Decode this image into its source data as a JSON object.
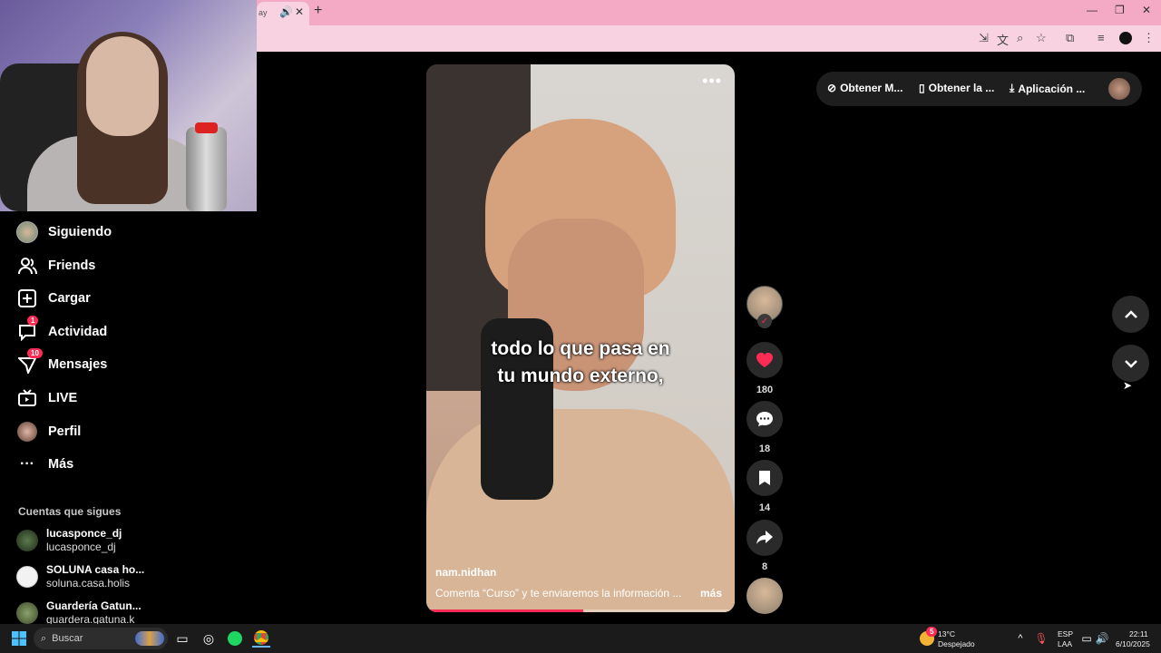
{
  "browser": {
    "tab_title": "ay",
    "icons": [
      "speaker-icon",
      "close-icon",
      "new-tab-icon"
    ],
    "address_icons": [
      "install-app-icon",
      "translate-icon",
      "zoom-icon",
      "bookmark-star-icon",
      "extensions-icon",
      "media-control-icon",
      "profile-icon",
      "kebab-menu-icon"
    ]
  },
  "sidebar": {
    "items": [
      {
        "label": "Siguiendo",
        "icon": "following-avatar-icon"
      },
      {
        "label": "Friends",
        "icon": "friends-icon"
      },
      {
        "label": "Cargar",
        "icon": "upload-icon"
      },
      {
        "label": "Actividad",
        "icon": "activity-icon",
        "badge": "1"
      },
      {
        "label": "Mensajes",
        "icon": "messages-icon",
        "badge": "10"
      },
      {
        "label": "LIVE",
        "icon": "live-icon"
      },
      {
        "label": "Perfil",
        "icon": "profile-avatar-icon"
      },
      {
        "label": "Más",
        "icon": "more-icon"
      }
    ],
    "following_title": "Cuentas que sigues",
    "accounts": [
      {
        "name": "lucasponce_dj",
        "handle": "lucasponce_dj"
      },
      {
        "name": "SOLUNA casa ho...",
        "handle": "soluna.casa.holis"
      },
      {
        "name": "Guardería Gatun...",
        "handle": "guardera.gatuna.k"
      }
    ]
  },
  "video": {
    "subtitle_line1": "todo lo que pasa en",
    "subtitle_line2": "tu mundo externo,",
    "username": "nam.nidhan",
    "description": "Comenta “Curso” y te enviaremos la información ...",
    "more": "más",
    "progress": 0.51
  },
  "actions": {
    "likes": "180",
    "comments": "18",
    "saves": "14",
    "shares": "8"
  },
  "top_pill": {
    "items": [
      "Obtener M...",
      "Obtener la ...",
      "Aplicación ..."
    ]
  },
  "taskbar": {
    "search_placeholder": "Buscar",
    "weather_temp": "13°C",
    "weather_desc": "Despejado",
    "weather_badge": "5",
    "lang1": "ESP",
    "lang2": "LAA",
    "time": "22:11",
    "date": "6/10/2025"
  },
  "colors": {
    "accent": "#fe2c55",
    "tabbar": "#f4a9c4",
    "background": "#000000"
  }
}
